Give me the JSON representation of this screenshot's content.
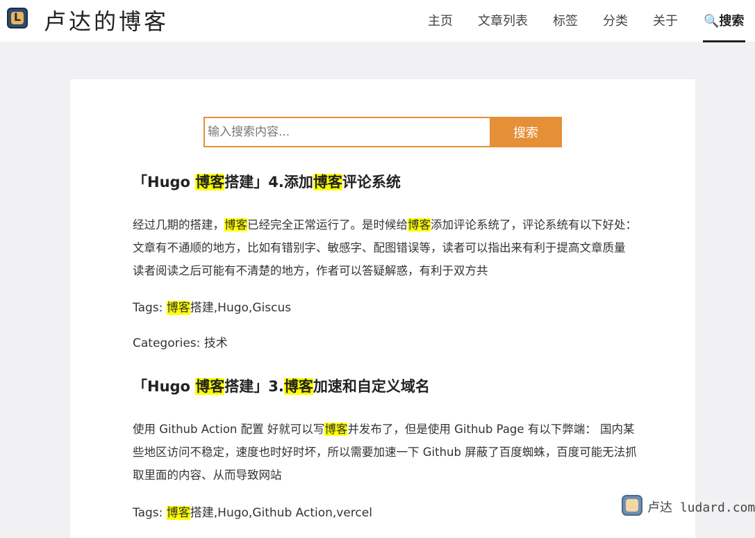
{
  "header": {
    "logo_letter": "L",
    "site_title": "卢达的博客",
    "nav": [
      {
        "label": "主页"
      },
      {
        "label": "文章列表"
      },
      {
        "label": "标签"
      },
      {
        "label": "分类"
      },
      {
        "label": "关于"
      },
      {
        "label": "🔍搜索",
        "active": true
      }
    ]
  },
  "search": {
    "placeholder": "输入搜索内容...",
    "button_label": "搜索",
    "keyword": "博客"
  },
  "results": [
    {
      "title_parts": [
        "「Hugo ",
        "博客",
        "搭建」4.添加",
        "博客",
        "评论系统"
      ],
      "summary_parts": [
        "经过几期的搭建，",
        "博客",
        "已经完全正常运行了。是时候给",
        "博客",
        "添加评论系统了，评论系统有以下好处： 文章有不通顺的地方，比如有错别字、敏感字、配图错误等，读者可以指出来有利于提高文章质量 读者阅读之后可能有不清楚的地方，作者可以答疑解惑，有利于双方共"
      ],
      "tags_label": "Tags: ",
      "tags_parts": [
        "博客",
        "搭建,Hugo,Giscus"
      ],
      "categories_label": "Categories: ",
      "categories": "技术"
    },
    {
      "title_parts": [
        "「Hugo ",
        "博客",
        "搭建」3.",
        "博客",
        "加速和自定义域名"
      ],
      "summary_parts": [
        "使用 Github Action 配置 好就可以写",
        "博客",
        "并发布了，但是使用 Github Page 有以下弊端： 国内某些地区访问不稳定，速度也时好时坏，所以需要加速一下 Github 屏蔽了百度蜘蛛，百度可能无法抓取里面的内容、从而导致网站"
      ],
      "tags_label": "Tags: ",
      "tags_parts": [
        "博客",
        "搭建,Hugo,Github Action,vercel"
      ]
    }
  ],
  "watermark": {
    "text": "卢达 ludard.com"
  },
  "colors": {
    "accent": "#e58f37",
    "highlight": "#ffff00",
    "background": "#f1f1f3"
  }
}
